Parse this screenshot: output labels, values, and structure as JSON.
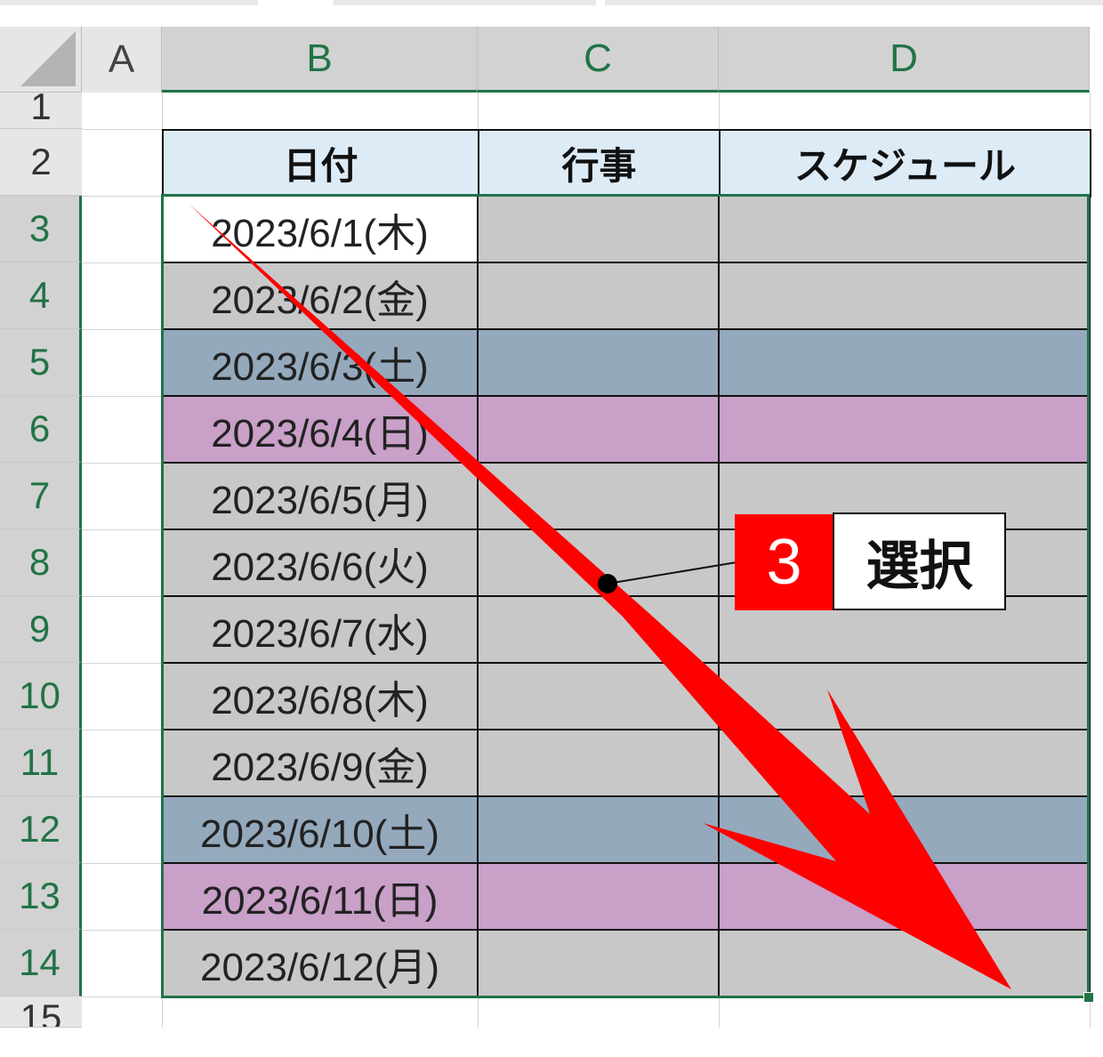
{
  "columns": [
    "A",
    "B",
    "C",
    "D"
  ],
  "rows": [
    "1",
    "2",
    "3",
    "4",
    "5",
    "6",
    "7",
    "8",
    "9",
    "10",
    "11",
    "12",
    "13",
    "14",
    "15"
  ],
  "table": {
    "headers": [
      "日付",
      "行事",
      "スケジュール"
    ],
    "dates": [
      "2023/6/1(木)",
      "2023/6/2(金)",
      "2023/6/3(土)",
      "2023/6/4(日)",
      "2023/6/5(月)",
      "2023/6/6(火)",
      "2023/6/7(水)",
      "2023/6/8(木)",
      "2023/6/9(金)",
      "2023/6/10(土)",
      "2023/6/11(日)",
      "2023/6/12(月)"
    ],
    "row_types": [
      "active",
      "weekday",
      "saturday",
      "sunday",
      "weekday",
      "weekday",
      "weekday",
      "weekday",
      "weekday",
      "saturday",
      "sunday",
      "weekday"
    ]
  },
  "colors": {
    "header_fill": "#ddebf7",
    "selected_fill": "#c8c8c8",
    "active_fill": "#ffffff",
    "saturday_fill": "#95a9bd",
    "sunday_fill": "#c8a0c8",
    "selection_border": "#217346",
    "annotation_red": "#ff0000"
  },
  "callout": {
    "number": "3",
    "label": "選択"
  },
  "icons": {
    "select_all": "select-all-triangle-icon",
    "arrow": "red-drag-arrow-icon"
  }
}
